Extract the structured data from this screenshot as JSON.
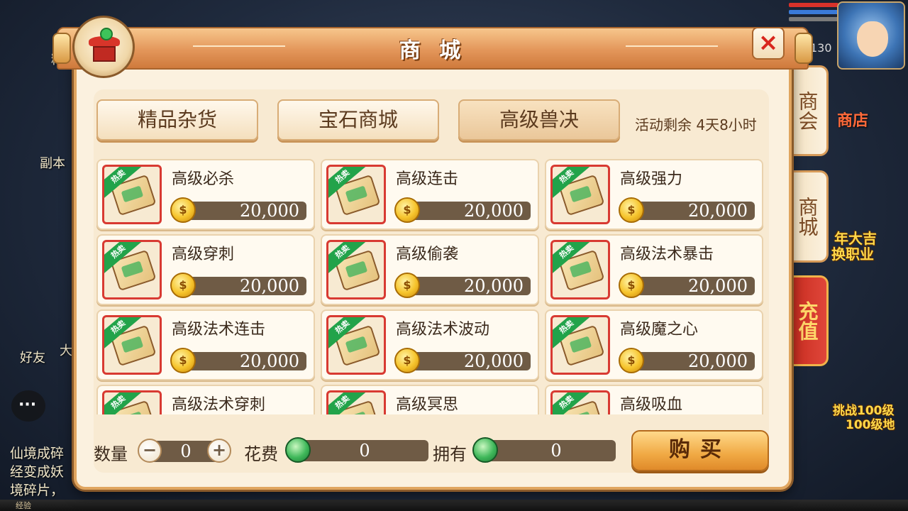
{
  "background": {
    "left_labels": [
      "精",
      "副本",
      "好友",
      "大"
    ],
    "right_labels": [
      "商店",
      "年大吉",
      "换职业",
      "挑战100级",
      "100级地"
    ],
    "chat_lines": [
      "仙境成碎",
      "经变成妖",
      "境碎片，"
    ],
    "level_text": "130",
    "bottom_label": "经验"
  },
  "panel": {
    "title": "商 城",
    "close_label": "×"
  },
  "side_tabs": [
    {
      "label": "商会"
    },
    {
      "label": "商城"
    },
    {
      "label": "充值"
    }
  ],
  "category_tabs": [
    {
      "label": "精品杂货"
    },
    {
      "label": "宝石商城"
    },
    {
      "label": "高级兽决"
    }
  ],
  "event_time": "活动剩余 4天8小时",
  "items": [
    {
      "name": "高级必杀",
      "price": "20,000",
      "badge": "热卖"
    },
    {
      "name": "高级连击",
      "price": "20,000",
      "badge": "热卖"
    },
    {
      "name": "高级强力",
      "price": "20,000",
      "badge": "热卖"
    },
    {
      "name": "高级穿刺",
      "price": "20,000",
      "badge": "热卖"
    },
    {
      "name": "高级偷袭",
      "price": "20,000",
      "badge": "热卖"
    },
    {
      "name": "高级法术暴击",
      "price": "20,000",
      "badge": "热卖"
    },
    {
      "name": "高级法术连击",
      "price": "20,000",
      "badge": "热卖"
    },
    {
      "name": "高级法术波动",
      "price": "20,000",
      "badge": "热卖"
    },
    {
      "name": "高级魔之心",
      "price": "20,000",
      "badge": "热卖"
    },
    {
      "name": "高级法术穿刺",
      "price": "",
      "badge": "热卖"
    },
    {
      "name": "高级冥思",
      "price": "",
      "badge": "热卖"
    },
    {
      "name": "高级吸血",
      "price": "",
      "badge": "热卖"
    }
  ],
  "coin_glyph": "$",
  "bottom": {
    "qty_label": "数量",
    "qty_value": "0",
    "minus": "−",
    "plus": "+",
    "cost_label": "花费",
    "cost_value": "0",
    "own_label": "拥有",
    "own_value": "0",
    "buy_label": "购买"
  }
}
